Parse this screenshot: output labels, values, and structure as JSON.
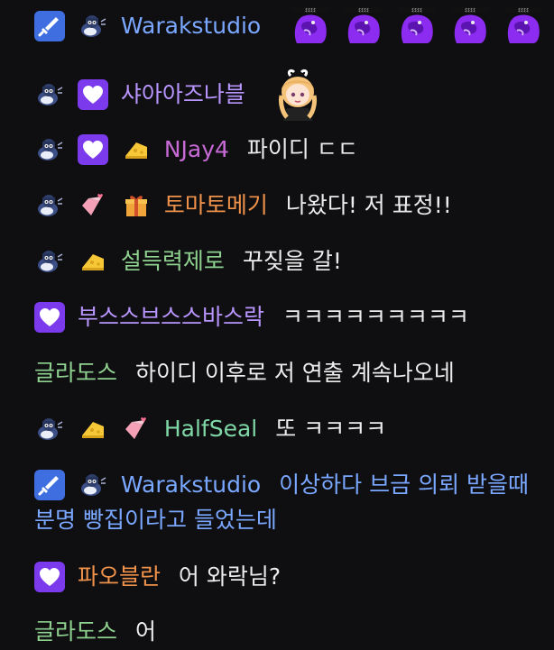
{
  "colors": {
    "background": "#0f0f12",
    "message_text": "#ececec",
    "blue_name": "#7aa7ff",
    "purple_name": "#c86ad6",
    "orange_name": "#f0924a",
    "green_name": "#8fd18f",
    "lavender_name": "#b996ff",
    "lightgreen_name": "#7fd7a6",
    "mod_badge": "#3f6ee0",
    "sub_badge": "#7c3aed"
  },
  "messages": [
    {
      "user": "Warakstudio",
      "text": "",
      "badges": [
        "sword-mod-badge",
        "penguin-badge"
      ],
      "emote_count": 5
    },
    {
      "user": "샤아아즈나블",
      "text": "",
      "badges": [
        "penguin-badge",
        "heart-sub-badge"
      ],
      "emote": "anime-girl-emote"
    },
    {
      "user": "NJay4",
      "text": "파이디 ㄷㄷ",
      "badges": [
        "penguin-badge",
        "heart-sub-badge",
        "cheese-badge"
      ]
    },
    {
      "user": "토마토메기",
      "text": "나왔다! 저 표정!!",
      "badges": [
        "penguin-badge",
        "pink-heart-badge",
        "gift-badge"
      ]
    },
    {
      "user": "설득력제로",
      "text": "꾸짖을 갈!",
      "badges": [
        "penguin-badge",
        "cheese-badge"
      ]
    },
    {
      "user": "부스스브스스바스락",
      "text": "ㅋㅋㅋㅋㅋㅋㅋㅋㅋ",
      "badges": [
        "heart-sub-badge"
      ]
    },
    {
      "user": "글라도스",
      "text": "하이디 이후로 저 연출 계속나오네",
      "badges": []
    },
    {
      "user": "HalfSeal",
      "text": "또 ㅋㅋㅋㅋ",
      "badges": [
        "penguin-badge",
        "cheese-badge",
        "pink-heart-badge"
      ]
    },
    {
      "user": "Warakstudio",
      "text": "이상하다 브금 의뢰 받을때 분명 빵집이라고 들었는데",
      "badges": [
        "sword-mod-badge",
        "penguin-badge"
      ]
    },
    {
      "user": "파오블란",
      "text": "어 와락님?",
      "badges": [
        "heart-sub-badge"
      ]
    },
    {
      "user": "글라도스",
      "text": "어",
      "badges": []
    }
  ]
}
